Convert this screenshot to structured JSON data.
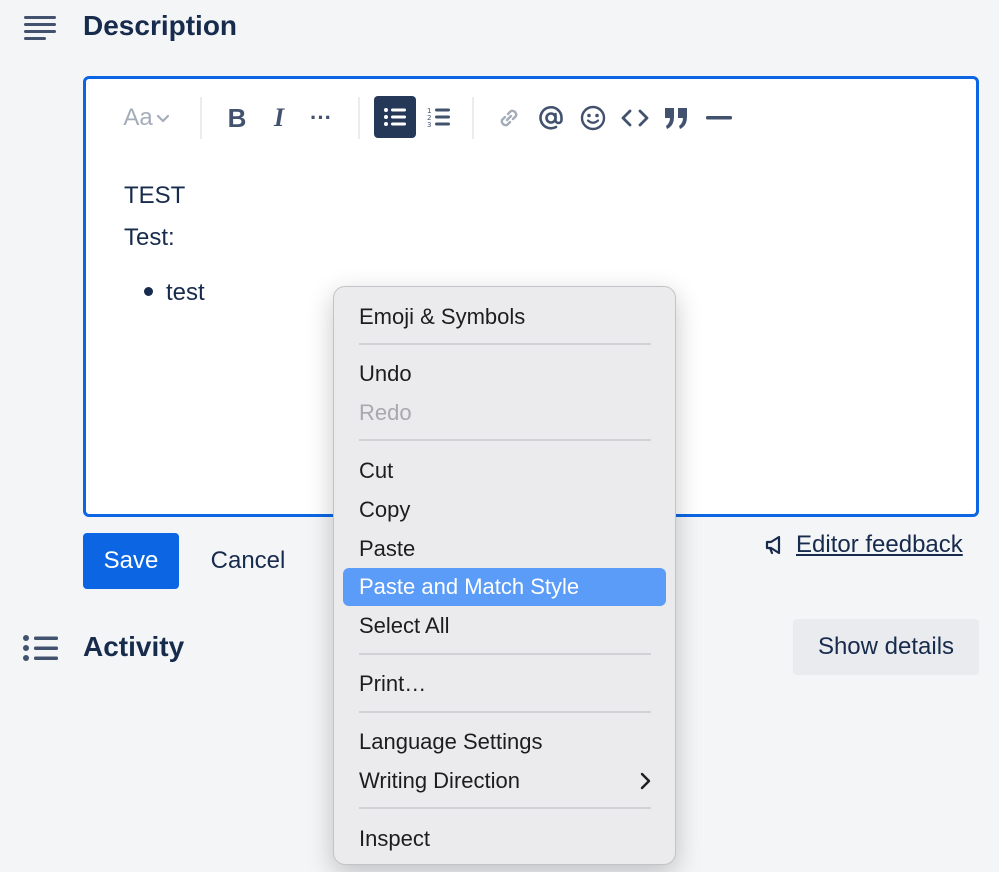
{
  "description": {
    "title": "Description",
    "icon": "text-lines-icon"
  },
  "toolbar": {
    "text_style_label": "Aa",
    "bold_label": "B",
    "italic_label": "I",
    "more_label": "···",
    "icons": [
      "text-style-icon",
      "bold-icon",
      "italic-icon",
      "more-icon",
      "bullet-list-icon",
      "numbered-list-icon",
      "link-icon",
      "mention-icon",
      "emoji-icon",
      "code-icon",
      "quote-icon",
      "divider-icon"
    ]
  },
  "editor": {
    "line1": "TEST",
    "line2": "Test:",
    "bullet1": "test"
  },
  "actions": {
    "save_label": "Save",
    "cancel_label": "Cancel",
    "feedback_label": "Editor feedback"
  },
  "activity": {
    "title": "Activity",
    "show_details_label": "Show details"
  },
  "context_menu": {
    "items": [
      {
        "label": "Emoji & Symbols"
      },
      {
        "label": "Undo"
      },
      {
        "label": "Redo",
        "disabled": true
      },
      {
        "label": "Cut"
      },
      {
        "label": "Copy"
      },
      {
        "label": "Paste"
      },
      {
        "label": "Paste and Match Style",
        "highlighted": true
      },
      {
        "label": "Select All"
      },
      {
        "label": "Print…"
      },
      {
        "label": "Language Settings"
      },
      {
        "label": "Writing Direction",
        "has_submenu": true
      },
      {
        "label": "Inspect"
      }
    ]
  },
  "colors": {
    "accent": "#0c66e4",
    "menu_highlight": "#5b9cf8",
    "background": "#f4f5f7"
  }
}
